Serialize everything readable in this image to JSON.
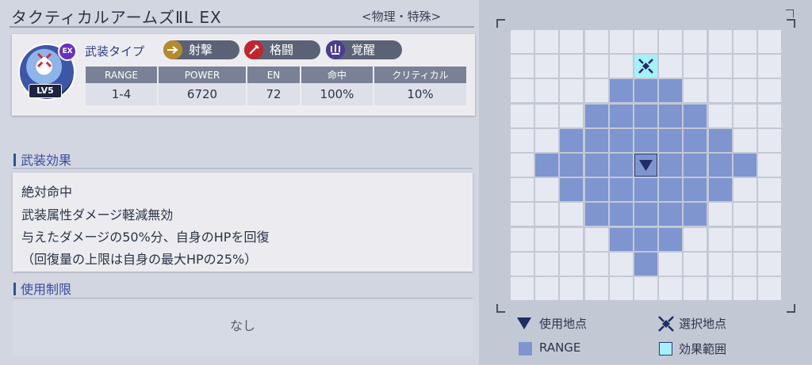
{
  "header": {
    "title": "タクティカルアームズⅡL EX",
    "subtitle": "<物理・特殊>"
  },
  "weapon": {
    "type_label": "武装タイプ",
    "badges": {
      "ex": "EX",
      "level": "LV5"
    },
    "chips": [
      {
        "label": "射撃",
        "icon": "shoot-icon",
        "color": "#b48a2e"
      },
      {
        "label": "格闘",
        "icon": "melee-icon",
        "color": "#c2242e"
      },
      {
        "label": "覚醒",
        "icon": "awaken-icon",
        "color": "#4b3c96"
      }
    ],
    "stats": {
      "headers": [
        "RANGE",
        "POWER",
        "EN",
        "命中",
        "クリティカル"
      ],
      "values": [
        "1-4",
        "6720",
        "72",
        "100%",
        "10%"
      ]
    }
  },
  "effects": {
    "heading": "武装効果",
    "lines": [
      "絶対命中",
      "武装属性ダメージ軽減無効",
      "与えたダメージの50%分、自身のHPを回復",
      "（回復量の上限は自身の最大HPの25%）"
    ]
  },
  "restrictions": {
    "heading": "使用制限",
    "text": "なし"
  },
  "range_map": {
    "rows": [
      "...........",
      ".....S.....",
      "....RRR....",
      "...RRRRR...",
      "..RRRRRRR..",
      ".RRRRCRRRR.",
      "..RRRRRRR..",
      "...RRRRR...",
      "....RRR....",
      ".....R.....",
      "..........."
    ],
    "legend_code": {
      ".": "empty",
      "R": "range",
      "C": "use-point",
      "S": "selected-point"
    }
  },
  "legend": {
    "use_point": "使用地点",
    "select_point": "選択地点",
    "range": "RANGE",
    "effect_area": "効果範囲"
  },
  "colors": {
    "range_cell": "#7e95cf",
    "effect_cell": "#a5f1fb",
    "empty_cell": "#e6e9f1",
    "accent": "#3a4ba0"
  }
}
